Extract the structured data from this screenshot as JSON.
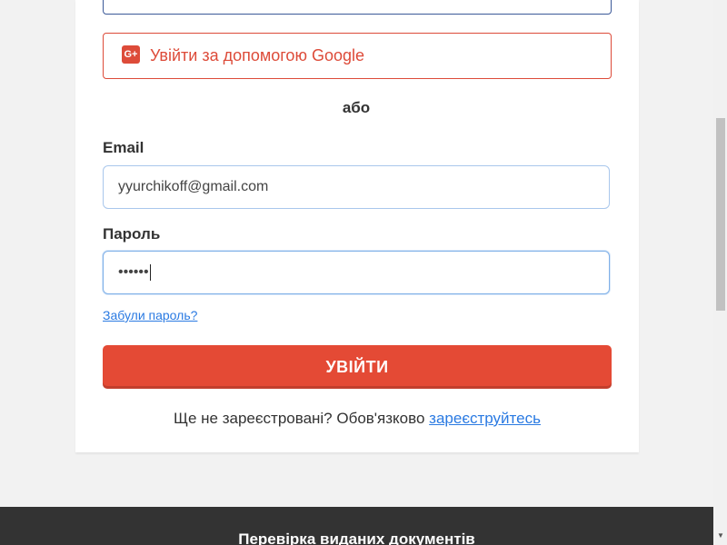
{
  "login": {
    "google_button_label": "Увійти за допомогою Google",
    "google_icon_glyph": "G+",
    "or_separator": "або",
    "email_label": "Email",
    "email_value": "yyurchikoff@gmail.com",
    "password_label": "Пароль",
    "password_value": "••••••",
    "forgot_password_link": "Забули пароль?",
    "submit_button": "УВІЙТИ",
    "register_prompt": "Ще не зареєстровані? Обов'язково",
    "register_link": "зареєструйтесь"
  },
  "footer": {
    "title": "Перевірка виданих документів"
  },
  "colors": {
    "google_red": "#dd4b39",
    "submit_red": "#e44a35",
    "link_blue": "#2a7ae2",
    "footer_bg": "#333333"
  },
  "icons": {
    "google": "google-plus-icon",
    "scroll_down": "scroll-down-arrow-icon"
  }
}
